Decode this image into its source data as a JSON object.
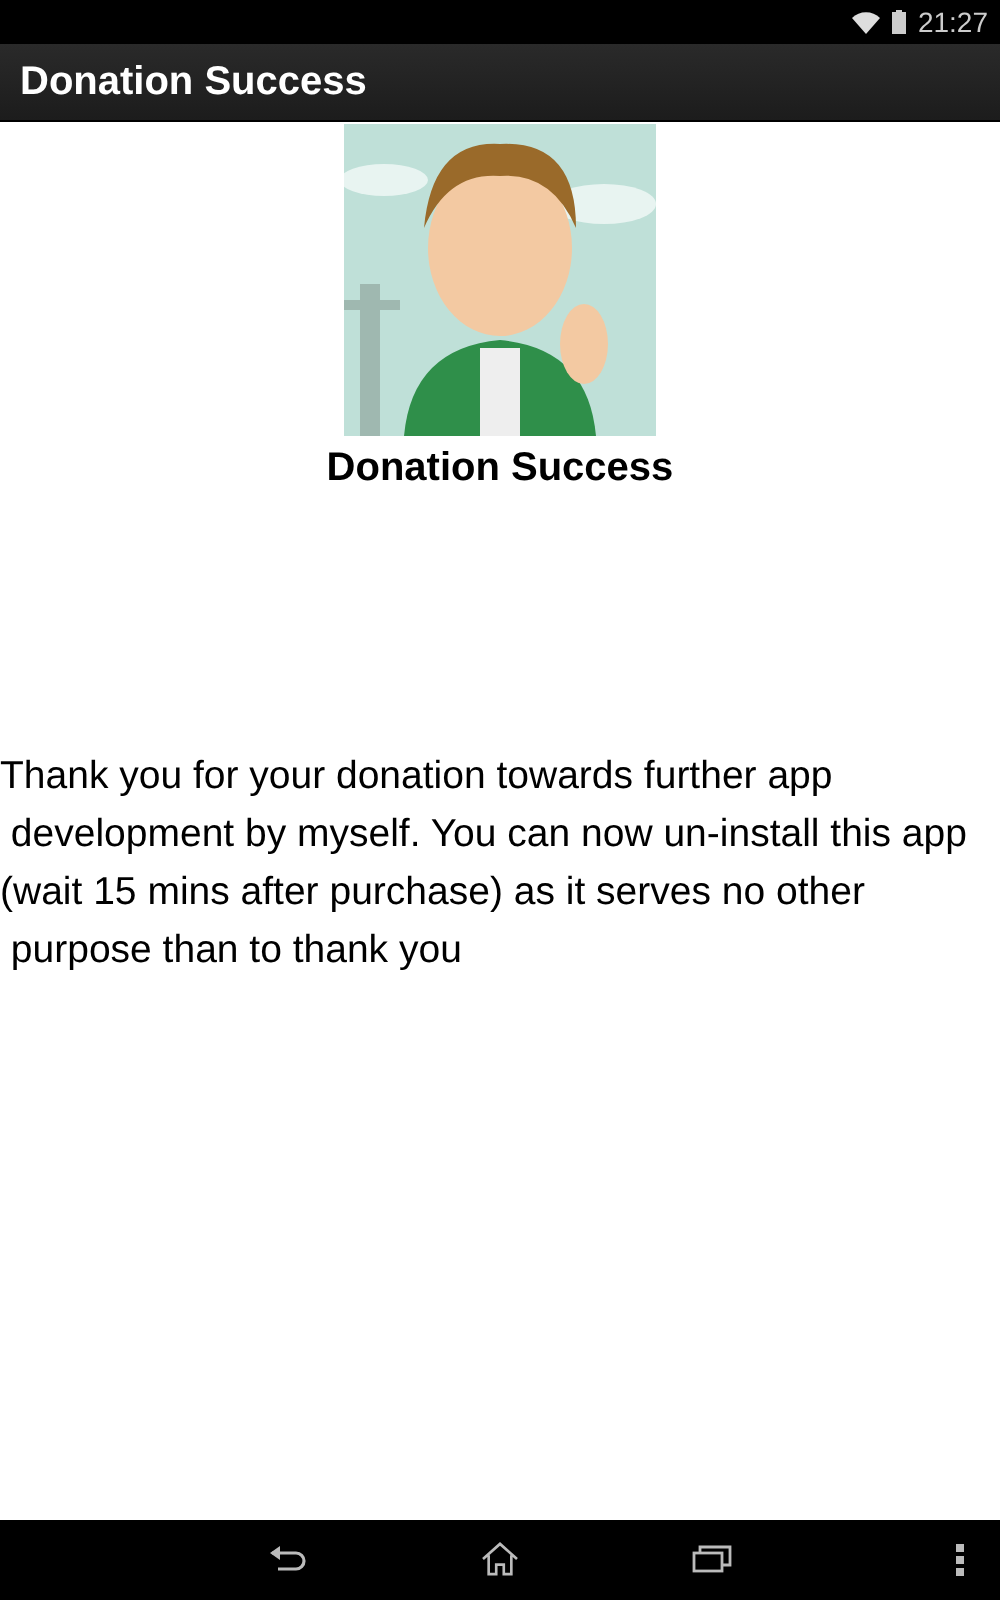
{
  "status_bar": {
    "time": "21:27"
  },
  "action_bar": {
    "title": "Donation Success"
  },
  "content": {
    "heading": "Donation Success",
    "message": "Thank you for your donation towards further app\n development by myself. You can now un-install this app\n(wait 15 mins after purchase) as it serves no other\n purpose than to thank you"
  }
}
